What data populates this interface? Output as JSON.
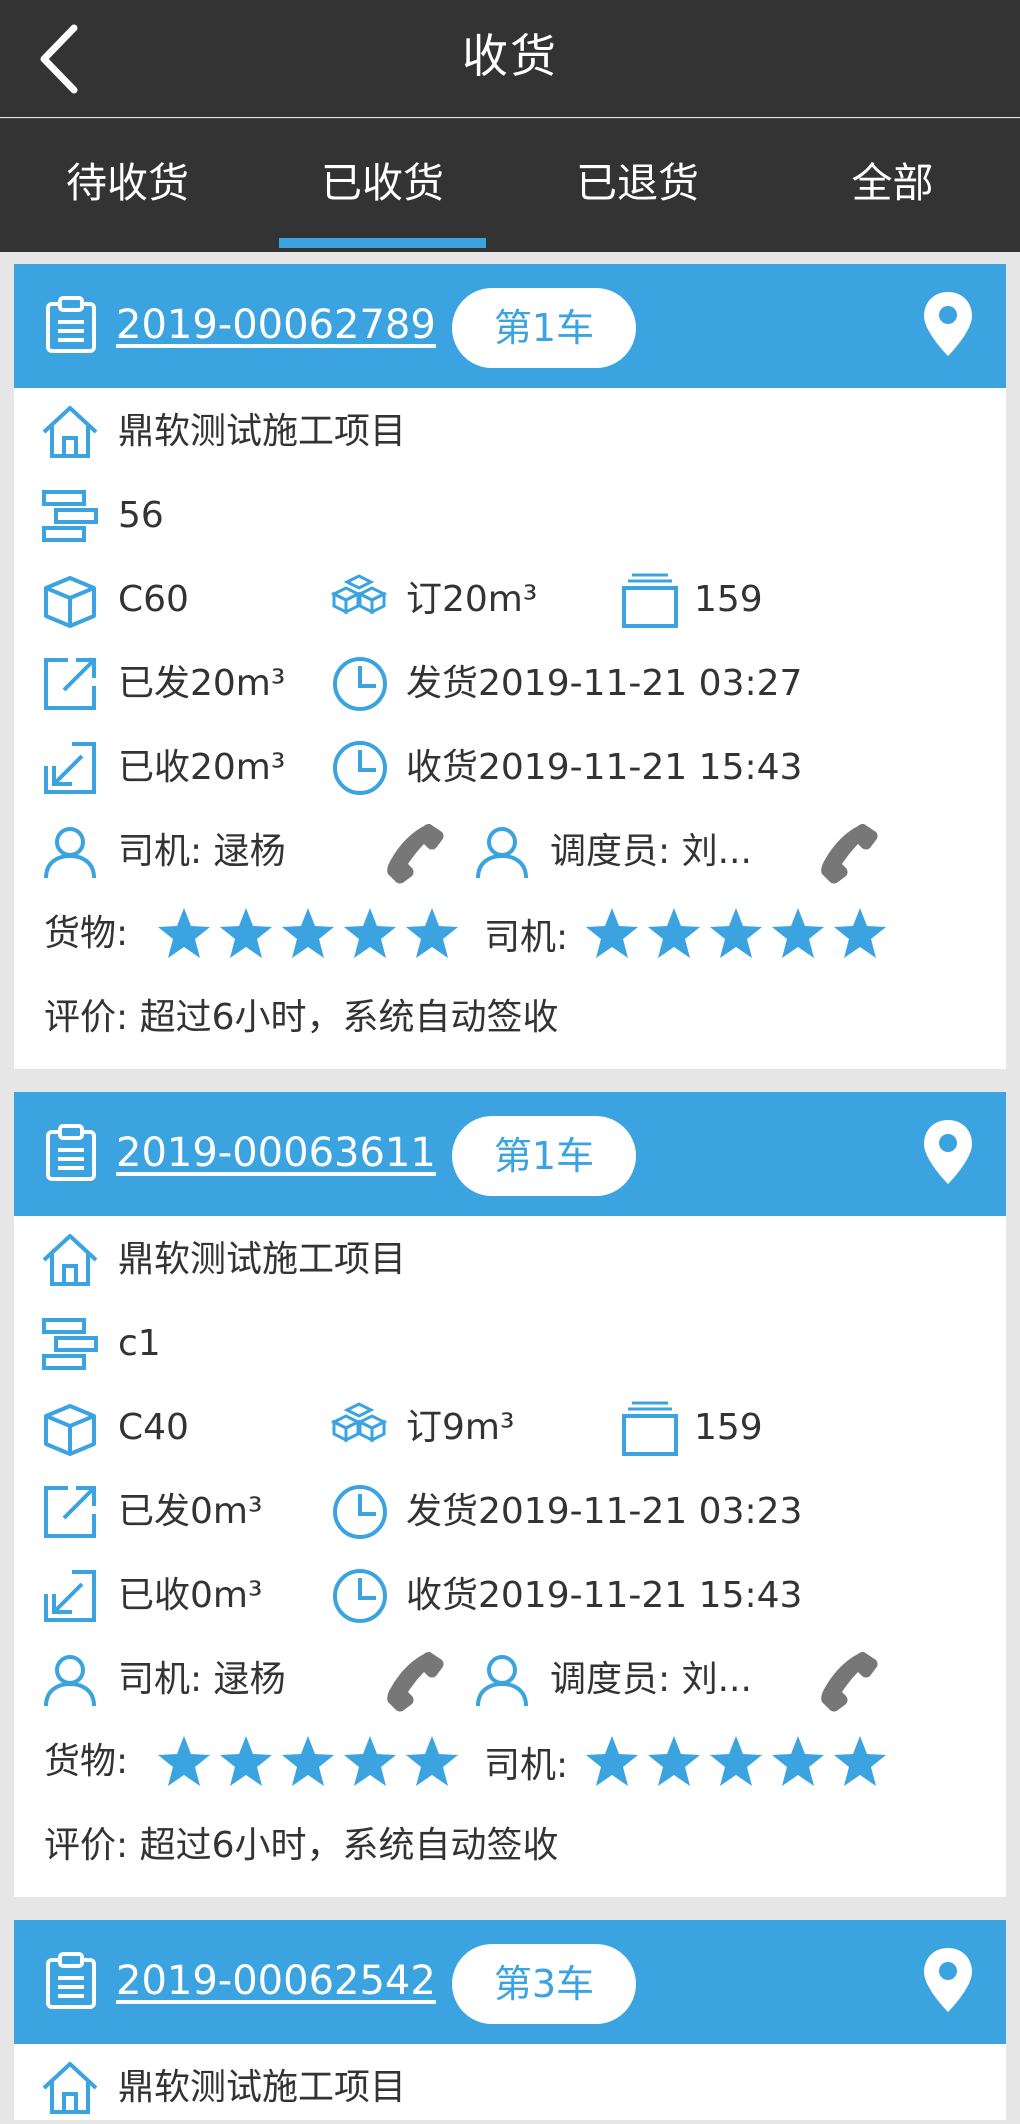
{
  "header": {
    "title": "收货"
  },
  "tabs": [
    {
      "label": "待收货"
    },
    {
      "label": "已收货"
    },
    {
      "label": "已退货"
    },
    {
      "label": "全部"
    }
  ],
  "colors": {
    "accent": "#3aa3e0",
    "topbar": "#333333",
    "phone": "#777777"
  },
  "labels": {
    "goods": "货物:",
    "driver_rating": "司机:"
  },
  "orders": [
    {
      "order_no": "2019-00062789",
      "truck": "第1车",
      "project": "鼎软测试施工项目",
      "part": "56",
      "grade": "C60",
      "ordered": "订20m³",
      "count": "159",
      "shipped": "已发20m³",
      "ship_time": "发货2019-11-21 03:27",
      "received": "已收20m³",
      "receive_time": "收货2019-11-21 15:43",
      "driver": "司机: 逯杨",
      "dispatcher": "调度员: 刘...",
      "goods_stars": 5,
      "driver_stars": 5,
      "comment": "评价:   超过6小时，系统自动签收"
    },
    {
      "order_no": "2019-00063611",
      "truck": "第1车",
      "project": "鼎软测试施工项目",
      "part": "c1",
      "grade": "C40",
      "ordered": "订9m³",
      "count": "159",
      "shipped": "已发0m³",
      "ship_time": "发货2019-11-21 03:23",
      "received": "已收0m³",
      "receive_time": "收货2019-11-21 15:43",
      "driver": "司机: 逯杨",
      "dispatcher": "调度员: 刘...",
      "goods_stars": 5,
      "driver_stars": 5,
      "comment": "评价:   超过6小时，系统自动签收"
    },
    {
      "order_no": "2019-00062542",
      "truck": "第3车",
      "project": "鼎软测试施工项目"
    }
  ]
}
